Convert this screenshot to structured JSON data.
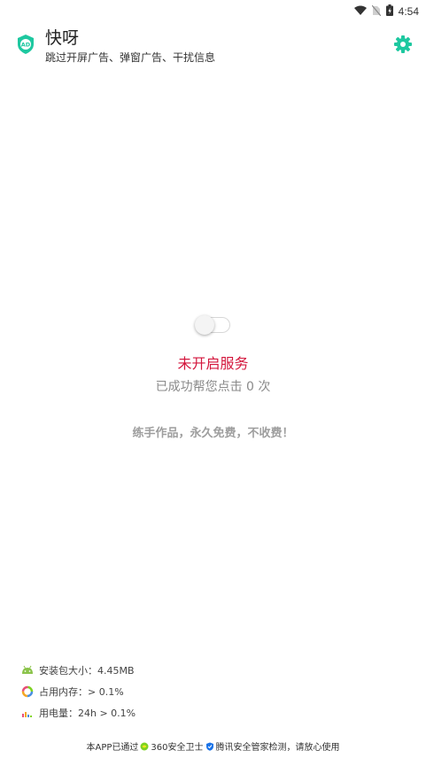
{
  "status_bar": {
    "time": "4:54",
    "icons": [
      "wifi-icon",
      "no-sim-icon",
      "battery-icon"
    ]
  },
  "header": {
    "title": "快呀",
    "subtitle": "跳过开屏广告、弹窗广告、干扰信息",
    "logo_label": "AD",
    "settings_icon": "gear-icon"
  },
  "main": {
    "service_toggle_on": false,
    "service_status": "未开启服务",
    "click_count_text": "已成功帮您点击 0 次",
    "slogan": "练手作品，永久免费，不收费！"
  },
  "info": {
    "package_size": "安装包大小：4.45MB",
    "memory_usage": "占用内存：> 0.1%",
    "battery_usage": "用电量：24h > 0.1%"
  },
  "footer": {
    "part1": "本APP已通过",
    "part2": "360安全卫士",
    "part3": "腾讯安全管家检测，请放心使用"
  },
  "colors": {
    "accent": "#1ec8a0",
    "status_red": "#d3163c",
    "muted": "#8a8a8a"
  }
}
